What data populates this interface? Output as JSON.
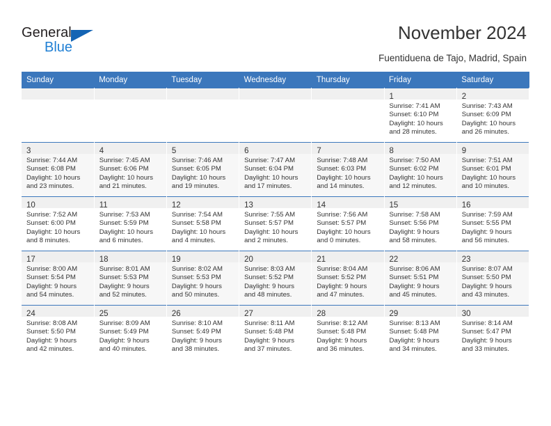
{
  "brand": {
    "name_part1": "General",
    "name_part2": "Blue"
  },
  "header": {
    "title": "November 2024",
    "subtitle": "Fuentiduena de Tajo, Madrid, Spain"
  },
  "colors": {
    "header_blue": "#3b77bc",
    "logo_blue": "#1f7fd4",
    "row_shade": "#f7f7f7",
    "daynum_strip": "#f0f0f0"
  },
  "weekdays": [
    "Sunday",
    "Monday",
    "Tuesday",
    "Wednesday",
    "Thursday",
    "Friday",
    "Saturday"
  ],
  "weeks": [
    [
      {
        "day": "",
        "sunrise": "",
        "sunset": "",
        "daylight1": "",
        "daylight2": ""
      },
      {
        "day": "",
        "sunrise": "",
        "sunset": "",
        "daylight1": "",
        "daylight2": ""
      },
      {
        "day": "",
        "sunrise": "",
        "sunset": "",
        "daylight1": "",
        "daylight2": ""
      },
      {
        "day": "",
        "sunrise": "",
        "sunset": "",
        "daylight1": "",
        "daylight2": ""
      },
      {
        "day": "",
        "sunrise": "",
        "sunset": "",
        "daylight1": "",
        "daylight2": ""
      },
      {
        "day": "1",
        "sunrise": "Sunrise: 7:41 AM",
        "sunset": "Sunset: 6:10 PM",
        "daylight1": "Daylight: 10 hours",
        "daylight2": "and 28 minutes."
      },
      {
        "day": "2",
        "sunrise": "Sunrise: 7:43 AM",
        "sunset": "Sunset: 6:09 PM",
        "daylight1": "Daylight: 10 hours",
        "daylight2": "and 26 minutes."
      }
    ],
    [
      {
        "day": "3",
        "sunrise": "Sunrise: 7:44 AM",
        "sunset": "Sunset: 6:08 PM",
        "daylight1": "Daylight: 10 hours",
        "daylight2": "and 23 minutes."
      },
      {
        "day": "4",
        "sunrise": "Sunrise: 7:45 AM",
        "sunset": "Sunset: 6:06 PM",
        "daylight1": "Daylight: 10 hours",
        "daylight2": "and 21 minutes."
      },
      {
        "day": "5",
        "sunrise": "Sunrise: 7:46 AM",
        "sunset": "Sunset: 6:05 PM",
        "daylight1": "Daylight: 10 hours",
        "daylight2": "and 19 minutes."
      },
      {
        "day": "6",
        "sunrise": "Sunrise: 7:47 AM",
        "sunset": "Sunset: 6:04 PM",
        "daylight1": "Daylight: 10 hours",
        "daylight2": "and 17 minutes."
      },
      {
        "day": "7",
        "sunrise": "Sunrise: 7:48 AM",
        "sunset": "Sunset: 6:03 PM",
        "daylight1": "Daylight: 10 hours",
        "daylight2": "and 14 minutes."
      },
      {
        "day": "8",
        "sunrise": "Sunrise: 7:50 AM",
        "sunset": "Sunset: 6:02 PM",
        "daylight1": "Daylight: 10 hours",
        "daylight2": "and 12 minutes."
      },
      {
        "day": "9",
        "sunrise": "Sunrise: 7:51 AM",
        "sunset": "Sunset: 6:01 PM",
        "daylight1": "Daylight: 10 hours",
        "daylight2": "and 10 minutes."
      }
    ],
    [
      {
        "day": "10",
        "sunrise": "Sunrise: 7:52 AM",
        "sunset": "Sunset: 6:00 PM",
        "daylight1": "Daylight: 10 hours",
        "daylight2": "and 8 minutes."
      },
      {
        "day": "11",
        "sunrise": "Sunrise: 7:53 AM",
        "sunset": "Sunset: 5:59 PM",
        "daylight1": "Daylight: 10 hours",
        "daylight2": "and 6 minutes."
      },
      {
        "day": "12",
        "sunrise": "Sunrise: 7:54 AM",
        "sunset": "Sunset: 5:58 PM",
        "daylight1": "Daylight: 10 hours",
        "daylight2": "and 4 minutes."
      },
      {
        "day": "13",
        "sunrise": "Sunrise: 7:55 AM",
        "sunset": "Sunset: 5:57 PM",
        "daylight1": "Daylight: 10 hours",
        "daylight2": "and 2 minutes."
      },
      {
        "day": "14",
        "sunrise": "Sunrise: 7:56 AM",
        "sunset": "Sunset: 5:57 PM",
        "daylight1": "Daylight: 10 hours",
        "daylight2": "and 0 minutes."
      },
      {
        "day": "15",
        "sunrise": "Sunrise: 7:58 AM",
        "sunset": "Sunset: 5:56 PM",
        "daylight1": "Daylight: 9 hours",
        "daylight2": "and 58 minutes."
      },
      {
        "day": "16",
        "sunrise": "Sunrise: 7:59 AM",
        "sunset": "Sunset: 5:55 PM",
        "daylight1": "Daylight: 9 hours",
        "daylight2": "and 56 minutes."
      }
    ],
    [
      {
        "day": "17",
        "sunrise": "Sunrise: 8:00 AM",
        "sunset": "Sunset: 5:54 PM",
        "daylight1": "Daylight: 9 hours",
        "daylight2": "and 54 minutes."
      },
      {
        "day": "18",
        "sunrise": "Sunrise: 8:01 AM",
        "sunset": "Sunset: 5:53 PM",
        "daylight1": "Daylight: 9 hours",
        "daylight2": "and 52 minutes."
      },
      {
        "day": "19",
        "sunrise": "Sunrise: 8:02 AM",
        "sunset": "Sunset: 5:53 PM",
        "daylight1": "Daylight: 9 hours",
        "daylight2": "and 50 minutes."
      },
      {
        "day": "20",
        "sunrise": "Sunrise: 8:03 AM",
        "sunset": "Sunset: 5:52 PM",
        "daylight1": "Daylight: 9 hours",
        "daylight2": "and 48 minutes."
      },
      {
        "day": "21",
        "sunrise": "Sunrise: 8:04 AM",
        "sunset": "Sunset: 5:52 PM",
        "daylight1": "Daylight: 9 hours",
        "daylight2": "and 47 minutes."
      },
      {
        "day": "22",
        "sunrise": "Sunrise: 8:06 AM",
        "sunset": "Sunset: 5:51 PM",
        "daylight1": "Daylight: 9 hours",
        "daylight2": "and 45 minutes."
      },
      {
        "day": "23",
        "sunrise": "Sunrise: 8:07 AM",
        "sunset": "Sunset: 5:50 PM",
        "daylight1": "Daylight: 9 hours",
        "daylight2": "and 43 minutes."
      }
    ],
    [
      {
        "day": "24",
        "sunrise": "Sunrise: 8:08 AM",
        "sunset": "Sunset: 5:50 PM",
        "daylight1": "Daylight: 9 hours",
        "daylight2": "and 42 minutes."
      },
      {
        "day": "25",
        "sunrise": "Sunrise: 8:09 AM",
        "sunset": "Sunset: 5:49 PM",
        "daylight1": "Daylight: 9 hours",
        "daylight2": "and 40 minutes."
      },
      {
        "day": "26",
        "sunrise": "Sunrise: 8:10 AM",
        "sunset": "Sunset: 5:49 PM",
        "daylight1": "Daylight: 9 hours",
        "daylight2": "and 38 minutes."
      },
      {
        "day": "27",
        "sunrise": "Sunrise: 8:11 AM",
        "sunset": "Sunset: 5:48 PM",
        "daylight1": "Daylight: 9 hours",
        "daylight2": "and 37 minutes."
      },
      {
        "day": "28",
        "sunrise": "Sunrise: 8:12 AM",
        "sunset": "Sunset: 5:48 PM",
        "daylight1": "Daylight: 9 hours",
        "daylight2": "and 36 minutes."
      },
      {
        "day": "29",
        "sunrise": "Sunrise: 8:13 AM",
        "sunset": "Sunset: 5:48 PM",
        "daylight1": "Daylight: 9 hours",
        "daylight2": "and 34 minutes."
      },
      {
        "day": "30",
        "sunrise": "Sunrise: 8:14 AM",
        "sunset": "Sunset: 5:47 PM",
        "daylight1": "Daylight: 9 hours",
        "daylight2": "and 33 minutes."
      }
    ]
  ]
}
